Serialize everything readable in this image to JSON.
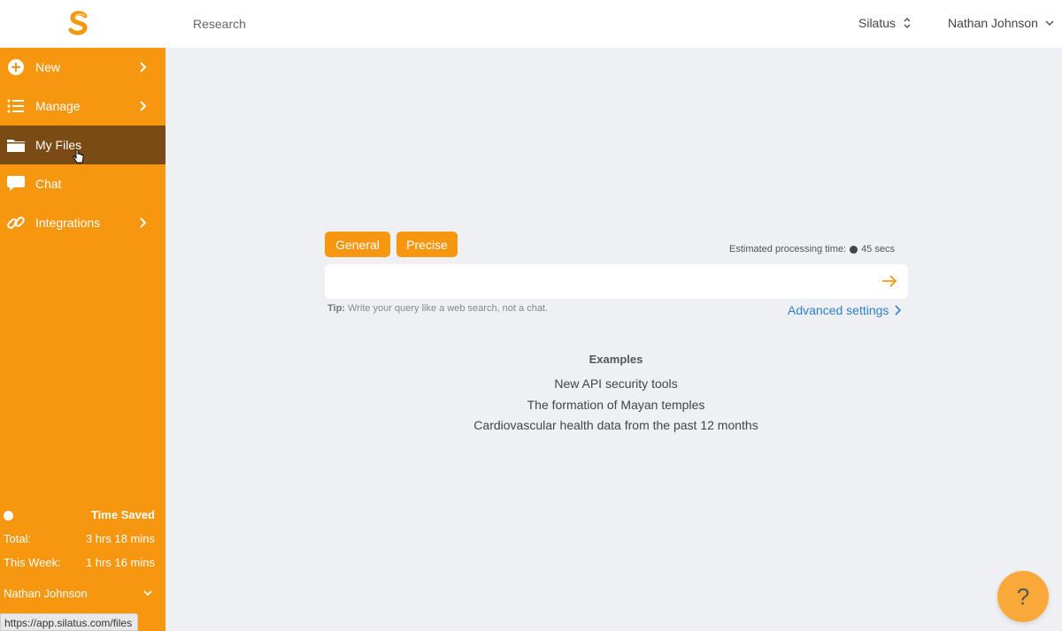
{
  "header": {
    "breadcrumb": "Research",
    "org_switcher": "Silatus",
    "user_menu": "Nathan Johnson"
  },
  "sidebar": {
    "items": [
      {
        "label": "New",
        "icon": "plus-circle-icon",
        "has_chevron": true
      },
      {
        "label": "Manage",
        "icon": "list-icon",
        "has_chevron": true
      },
      {
        "label": "My Files",
        "icon": "folder-icon",
        "active": true
      },
      {
        "label": "Chat",
        "icon": "chat-bubble-icon"
      },
      {
        "label": "Integrations",
        "icon": "link-icon",
        "has_chevron": true
      }
    ],
    "time_saved": {
      "title": "Time Saved",
      "total_label": "Total:",
      "total_value": "3 hrs 18 mins",
      "week_label": "This Week:",
      "week_value": "1 hrs 16 mins"
    },
    "user": "Nathan Johnson"
  },
  "status_bar_url": "https://app.silatus.com/files",
  "main": {
    "modes": [
      "General",
      "Precise"
    ],
    "estimate_label": "Estimated processing time:",
    "estimate_value": "45 secs",
    "search_placeholder": "",
    "tip_label": "Tip:",
    "tip_text": "Write your query like a web search, not a chat.",
    "advanced_settings": "Advanced settings",
    "examples_title": "Examples",
    "examples": [
      "New API security tools",
      "The formation of Mayan temples",
      "Cardiovascular health data from the past 12 months"
    ]
  },
  "help_button": "?",
  "colors": {
    "accent": "#f7960f",
    "sidebar_active": "#7a4b15",
    "link": "#2f7fc9",
    "background": "#eff0f3"
  }
}
